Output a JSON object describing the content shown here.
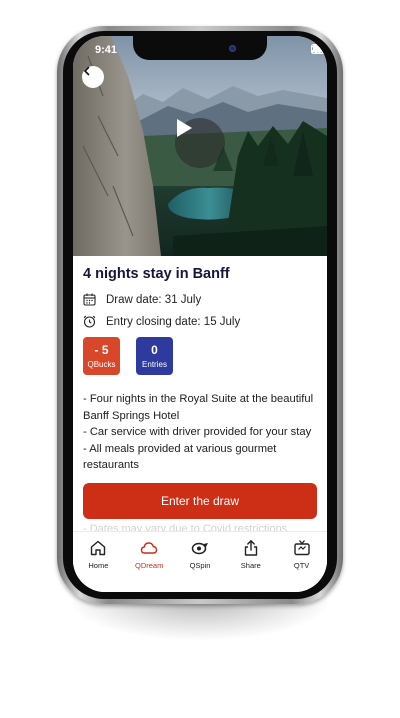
{
  "status_bar": {
    "time": "9:41"
  },
  "hero": {
    "play_label": "Play video"
  },
  "prize": {
    "title": "4 nights stay in Banff",
    "draw_date": "Draw date: 31 July",
    "closing_date": "Entry closing date: 15 July",
    "qbucks": {
      "value": "- 5",
      "label": "QBucks",
      "color": "#D9472A"
    },
    "entries": {
      "value": "0",
      "label": "Entries",
      "color": "#2E3A9E"
    },
    "description": [
      "- Four nights in the Royal Suite at the beautiful Banff Springs Hotel",
      "- Car service with driver provided for your stay",
      "- All meals provided at various gourmet restaurants"
    ],
    "partial_line": "- Dates may vary due to Covid restrictions"
  },
  "cta": {
    "label": "Enter the draw",
    "color": "#CC2E16"
  },
  "tabs": [
    {
      "label": "Home",
      "icon": "home-icon",
      "active": false
    },
    {
      "label": "QDream",
      "icon": "cloud-icon",
      "active": true
    },
    {
      "label": "QSpin",
      "icon": "spin-icon",
      "active": false
    },
    {
      "label": "Share",
      "icon": "share-icon",
      "active": false
    },
    {
      "label": "QTV",
      "icon": "tv-icon",
      "active": false
    }
  ]
}
